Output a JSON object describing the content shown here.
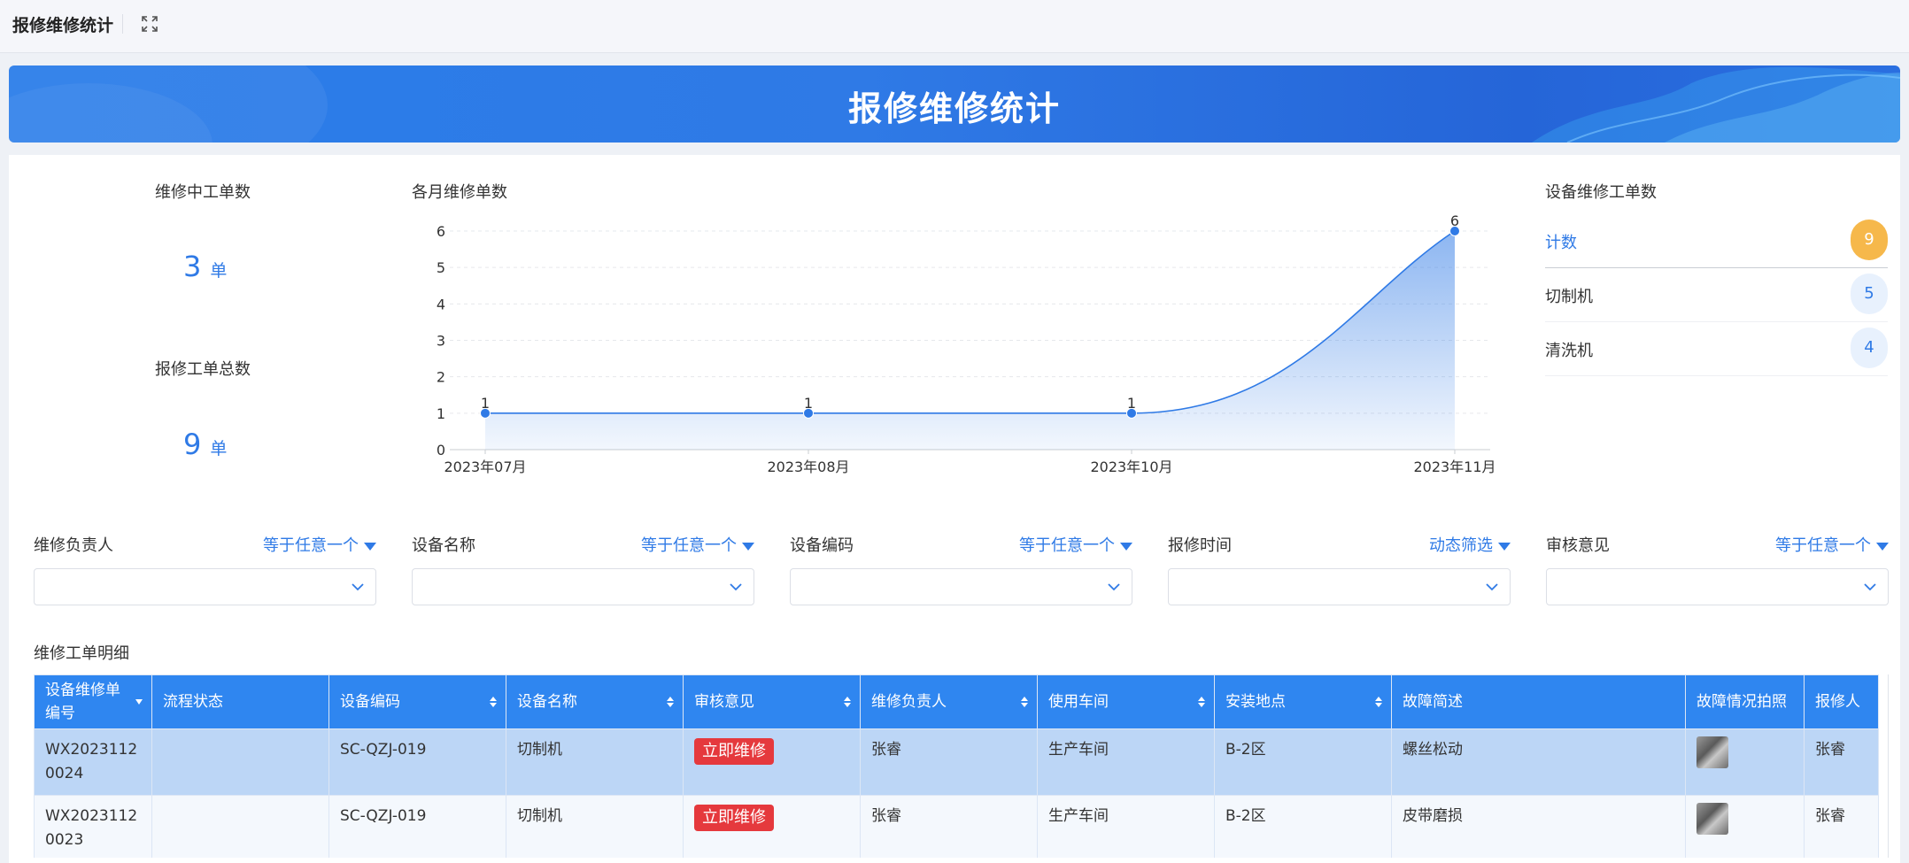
{
  "app": {
    "title": "报修维修统计"
  },
  "banner": {
    "title": "报修维修统计"
  },
  "stats": {
    "in_progress_label": "维修中工单数",
    "in_progress_value": "3",
    "total_label": "报修工单总数",
    "total_value": "9",
    "unit": "单"
  },
  "chart": {
    "title": "各月维修单数"
  },
  "chart_data": {
    "type": "area",
    "categories": [
      "2023年07月",
      "2023年08月",
      "2023年10月",
      "2023年11月"
    ],
    "values": [
      1,
      1,
      1,
      6
    ],
    "ylim": [
      0,
      6
    ],
    "yticks": [
      0,
      1,
      2,
      3,
      4,
      5,
      6
    ],
    "data_labels": true,
    "grid": true,
    "color": "#2f7ae6"
  },
  "rank": {
    "title": "设备维修工单数",
    "rows": [
      {
        "name": "计数",
        "count": "9",
        "highlight": true
      },
      {
        "name": "切制机",
        "count": "5",
        "highlight": false
      },
      {
        "name": "清洗机",
        "count": "4",
        "highlight": false
      }
    ]
  },
  "filters": [
    {
      "label": "维修负责人",
      "op": "等于任意一个"
    },
    {
      "label": "设备名称",
      "op": "等于任意一个"
    },
    {
      "label": "设备编码",
      "op": "等于任意一个"
    },
    {
      "label": "报修时间",
      "op": "动态筛选"
    },
    {
      "label": "审核意见",
      "op": "等于任意一个"
    }
  ],
  "table": {
    "title": "维修工单明细",
    "columns": [
      "设备维修单编号",
      "流程状态",
      "设备编码",
      "设备名称",
      "审核意见",
      "维修负责人",
      "使用车间",
      "安装地点",
      "故障简述",
      "故障情况拍照",
      "报修人"
    ],
    "rows": [
      [
        "WX20231120024",
        "",
        "SC-QZJ-019",
        "切制机",
        "立即维修",
        "张睿",
        "生产车间",
        "B-2区",
        "螺丝松动",
        "",
        "张睿"
      ],
      [
        "WX20231120023",
        "",
        "SC-QZJ-019",
        "切制机",
        "立即维修",
        "张睿",
        "生产车间",
        "B-2区",
        "皮带磨损",
        "",
        "张睿"
      ]
    ]
  },
  "colors": {
    "accent": "#2f7ae6",
    "header_bg": "#2f86f0",
    "tag_red": "#e5393d",
    "badge_gold": "#f6b84b"
  }
}
